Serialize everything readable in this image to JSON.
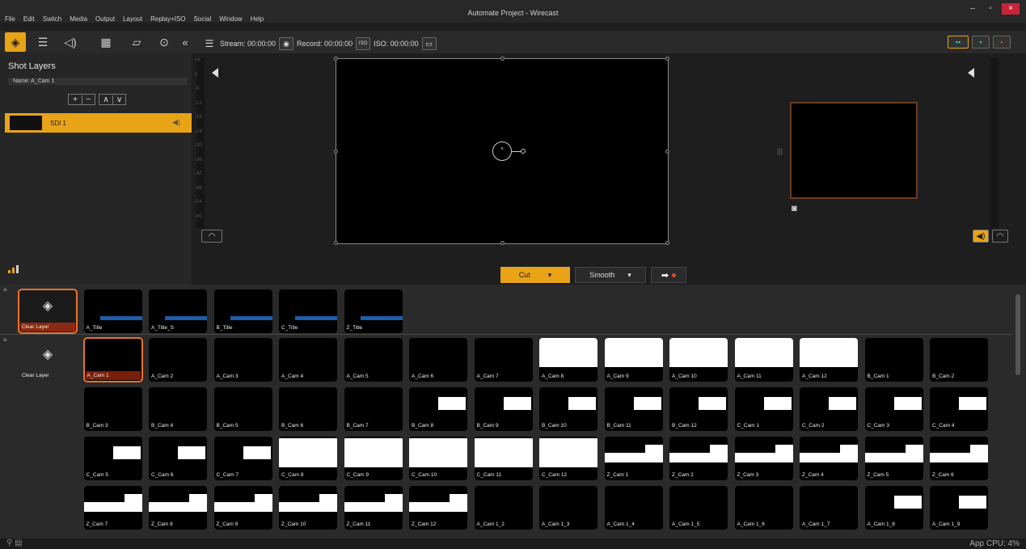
{
  "window": {
    "title": "Automate Project - Wirecast",
    "minimize": "–",
    "maximize": "▫",
    "close": "×"
  },
  "menu": [
    "File",
    "Edit",
    "Switch",
    "Media",
    "Output",
    "Layout",
    "Replay+ISO",
    "Social",
    "Window",
    "Help"
  ],
  "toolbar": {
    "stream_label": "Stream: 00:00:00",
    "record_label": "Record: 00:00:00",
    "iso_label": "ISO: 00:00:00",
    "collapse": "«"
  },
  "shot_layers": {
    "title": "Shot Layers",
    "name_field": "Name:  A_Cam 1",
    "add": "+",
    "remove": "−",
    "up": "∧",
    "down": "∨",
    "layer_name": "SDI 1"
  },
  "meter_scale": [
    "+6",
    "0",
    "-6",
    "-12",
    "-18",
    "-24",
    "-30",
    "-36",
    "-42",
    "-48",
    "-54",
    "-60"
  ],
  "transition": {
    "cut_label": "Cut",
    "smooth_label": "Smooth"
  },
  "shots": {
    "layer_row_1": [
      {
        "label": "Clear Layer",
        "kind": "clear"
      },
      {
        "label": "A_Title",
        "kind": "title"
      },
      {
        "label": "A_Title_S",
        "kind": "title"
      },
      {
        "label": "B_Title",
        "kind": "title"
      },
      {
        "label": "C_Title",
        "kind": "title"
      },
      {
        "label": "Z_Title",
        "kind": "title"
      }
    ],
    "layer_row_2": [
      {
        "label": "Clear Layer",
        "kind": "clear2"
      },
      {
        "label": "A_Cam 1",
        "kind": "black",
        "selected": true
      },
      {
        "label": "A_Cam 2",
        "kind": "black"
      },
      {
        "label": "A_Cam 3",
        "kind": "black"
      },
      {
        "label": "A_Cam 4",
        "kind": "black"
      },
      {
        "label": "A_Cam 5",
        "kind": "black"
      },
      {
        "label": "A_Cam 6",
        "kind": "black"
      },
      {
        "label": "A_Cam 7",
        "kind": "black"
      },
      {
        "label": "A_Cam 8",
        "kind": "white"
      },
      {
        "label": "A_Cam 9",
        "kind": "white"
      },
      {
        "label": "A_Cam 10",
        "kind": "white"
      },
      {
        "label": "A_Cam 11",
        "kind": "white"
      },
      {
        "label": "A_Cam 12",
        "kind": "white"
      },
      {
        "label": "B_Cam 1",
        "kind": "black"
      },
      {
        "label": "B_Cam 2",
        "kind": "black"
      }
    ],
    "row_3": [
      "B_Cam 3",
      "B_Cam 4",
      "B_Cam 5",
      "B_Cam 6",
      "B_Cam 7",
      "B_Cam 8",
      "B_Cam 9",
      "B_Cam 10",
      "B_Cam 11",
      "B_Cam 12",
      "C_Cam 1",
      "C_Cam 2",
      "C_Cam 3",
      "C_Cam 4"
    ],
    "row_4": [
      "C_Cam 5",
      "C_Cam 6",
      "C_Cam 7",
      "C_Cam 8",
      "C_Cam 9",
      "C_Cam 10",
      "C_Cam 11",
      "C_Cam 12",
      "Z_Cam 1",
      "Z_Cam 2",
      "Z_Cam 3",
      "Z_Cam 4",
      "Z_Cam 5",
      "Z_Cam 6"
    ],
    "row_5": [
      "Z_Cam 7",
      "Z_Cam 8",
      "Z_Cam 9",
      "Z_Cam 10",
      "Z_Cam 11",
      "Z_Cam 12",
      "A_Cam 1_2",
      "A_Cam 1_3",
      "A_Cam 1_4",
      "A_Cam 1_5",
      "A_Cam 1_6",
      "A_Cam 1_7",
      "A_Cam 1_8",
      "A_Cam 1_9"
    ]
  },
  "status": {
    "cpu": "App CPU:  4%"
  },
  "colors": {
    "accent": "#e8a317",
    "selected_outline": "#e8732a",
    "title_bar_blue": "#1e5ca8"
  }
}
